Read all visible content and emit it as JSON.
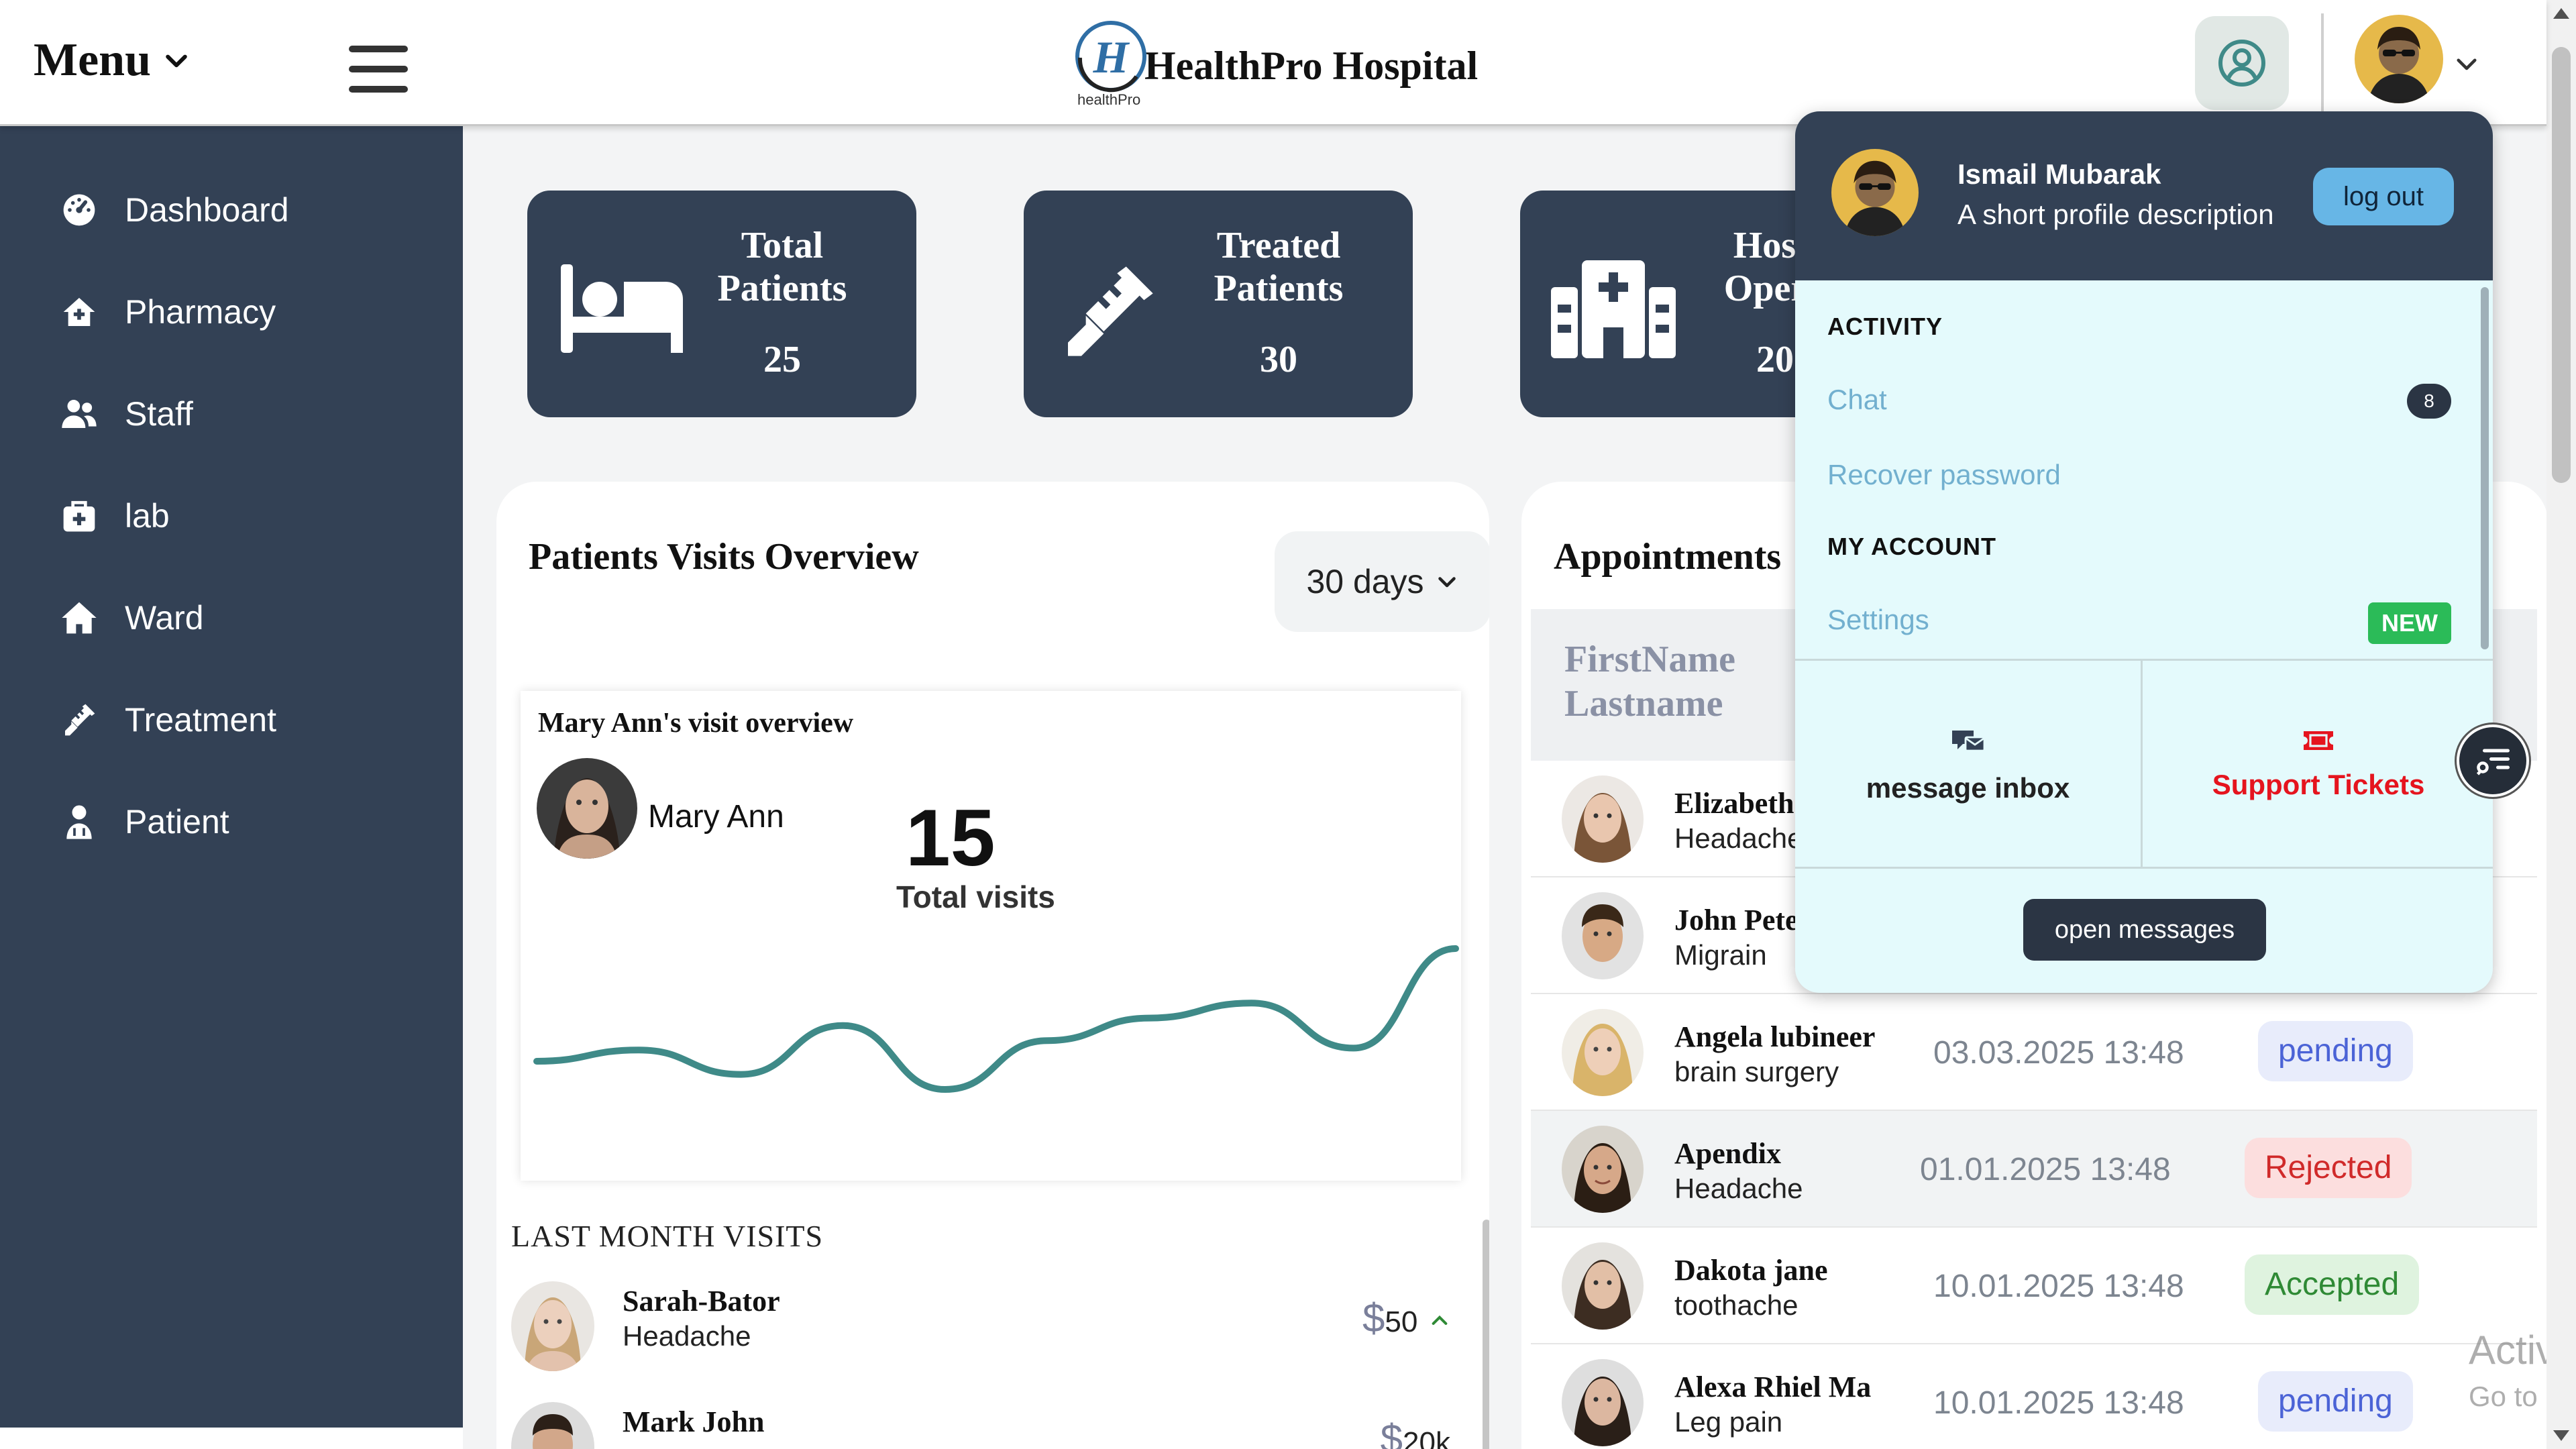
{
  "header": {
    "menu_label": "Menu",
    "brand_name": "HealthPro Hospital",
    "brand_logo_letter": "H",
    "brand_sub": "healthPro",
    "icons": [
      "chevron-down-icon",
      "hamburger-icon",
      "account-circle-icon"
    ]
  },
  "sidebar": {
    "items": [
      {
        "label": "Dashboard",
        "icon": "dashboard-gauge-icon"
      },
      {
        "label": "Pharmacy",
        "icon": "pharmacy-house-icon"
      },
      {
        "label": "Staff",
        "icon": "staff-users-icon"
      },
      {
        "label": "lab",
        "icon": "lab-kit-icon"
      },
      {
        "label": "Ward",
        "icon": "ward-house-icon"
      },
      {
        "label": "Treatment",
        "icon": "treatment-syringe-icon"
      },
      {
        "label": "Patient",
        "icon": "patient-user-icon"
      }
    ]
  },
  "stats": [
    {
      "title": "Total Patients",
      "value": "25",
      "icon": "bed-icon"
    },
    {
      "title": "Treated Patients",
      "value": "30",
      "icon": "syringe-icon"
    },
    {
      "title": "Hosp Opera",
      "value": "20",
      "icon": "hospital-icon"
    }
  ],
  "visits": {
    "title": "Patients Visits Overview",
    "range": "30 days",
    "card_title": "Mary Ann's visit overview",
    "patient_name": "Mary Ann",
    "total": "15",
    "total_label": "Total visits",
    "last_month_title": "LAST MONTH VISITS",
    "last_month": [
      {
        "name": "Sarah-Bator",
        "condition": "Headache",
        "currency": "$",
        "amount": "50"
      },
      {
        "name": "Mark John",
        "condition": "",
        "currency": "$",
        "amount": "20k"
      }
    ]
  },
  "chart_data": {
    "type": "line",
    "title": "",
    "xlabel": "",
    "ylabel": "",
    "series": [
      {
        "values": [
          3.5,
          4.1,
          2.8,
          5.4,
          2.0,
          4.6,
          5.8,
          6.6,
          4.2,
          9.5
        ]
      }
    ],
    "ylim": [
      0,
      10
    ],
    "grid": false,
    "color": "#3f8a88"
  },
  "appointments": {
    "title": "Appointments",
    "col_name": "FirstName Lastname",
    "rows": [
      {
        "name": "Elizabeth",
        "condition": "Headache",
        "date": "",
        "status": "",
        "status_type": ""
      },
      {
        "name": "John Peter",
        "condition": "Migrain",
        "date": "",
        "status": "",
        "status_type": ""
      },
      {
        "name": "Angela lubineer",
        "condition": "brain surgery",
        "date": "03.03.2025 13:48",
        "status": "pending",
        "status_type": "pending"
      },
      {
        "name": "Apendix",
        "condition": "Headache",
        "date": "01.01.2025 13:48",
        "status": "Rejected",
        "status_type": "rejected"
      },
      {
        "name": "Dakota jane",
        "condition": "toothache",
        "date": "10.01.2025 13:48",
        "status": "Accepted",
        "status_type": "accepted"
      },
      {
        "name": "Alexa Rhiel Ma",
        "condition": "Leg pain",
        "date": "10.01.2025 13:48",
        "status": "pending",
        "status_type": "pending"
      }
    ]
  },
  "profile": {
    "name": "Ismail Mubarak",
    "description": "A short profile description",
    "logout_label": "log out",
    "activity_header": "ACTIVITY",
    "chat_label": "Chat",
    "chat_count": "8",
    "recover_label": "Recover password",
    "account_header": "MY ACCOUNT",
    "settings_label": "Settings",
    "settings_badge": "NEW",
    "inbox_label": "message inbox",
    "tickets_label": "Support Tickets",
    "open_messages_label": "open messages"
  },
  "watermark": {
    "title": "Activate Windows",
    "subtitle": "Go to Settings to activate Windows."
  },
  "colors": {
    "sidebar": "#334155",
    "accent_line": "#3f8a88",
    "dropdown_body": "#e4fafc",
    "logout": "#67b6e6",
    "new_badge": "#2bbb58",
    "tickets": "#e5141e"
  }
}
